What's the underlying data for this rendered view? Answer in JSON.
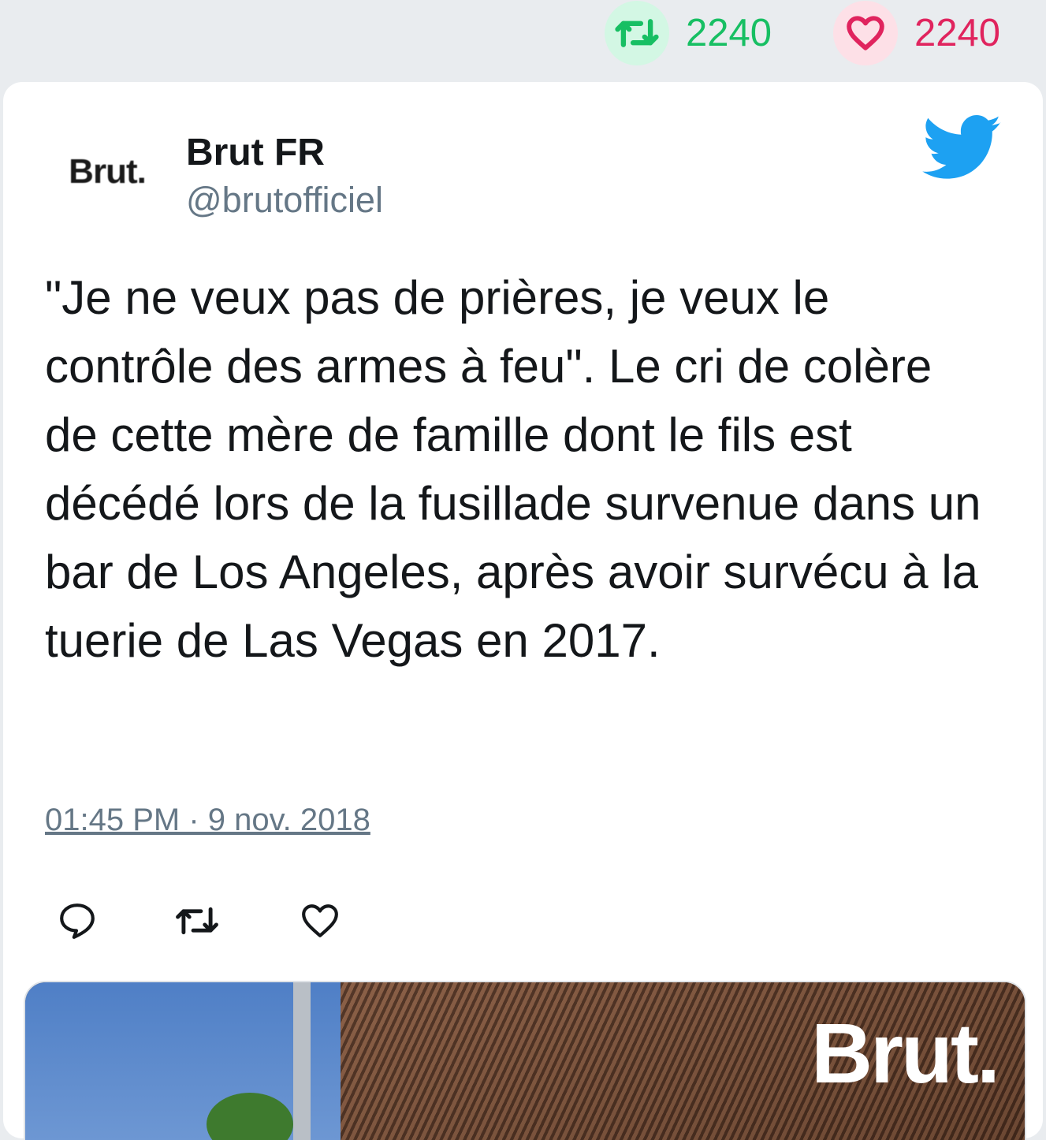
{
  "stats": {
    "retweet_count": "2240",
    "like_count": "2240",
    "retweet_color": "#17bf63",
    "like_color": "#e0245e"
  },
  "tweet": {
    "avatar_text": "Brut.",
    "author_name": "Brut FR",
    "author_handle": "@brutofficiel",
    "text": "\"Je ne veux pas de prières, je veux le contrôle des armes à feu\". Le cri de colère de cette mère de famille dont le fils est décédé lors de la fusillade survenue dans un bar de Los Angeles, après avoir survécu à la tuerie de Las Vegas en 2017.",
    "timestamp": "01:45 PM · 9 nov. 2018",
    "icons": [
      "twitter-bird-icon",
      "reply-icon",
      "retweet-icon",
      "heart-icon"
    ],
    "brand_color": "#1da1f2"
  },
  "media": {
    "logo_text": "Brut."
  }
}
